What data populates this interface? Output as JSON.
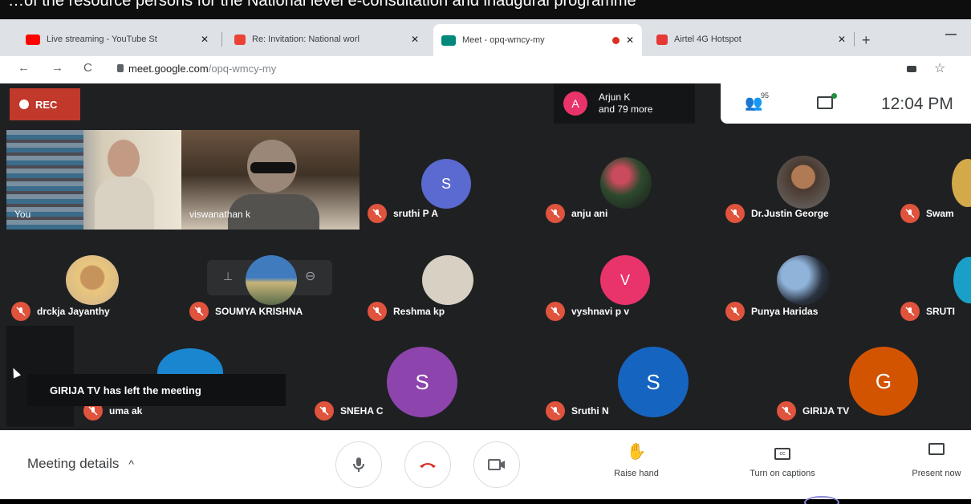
{
  "top_strip": {
    "text": "…of the resource persons for the National level e-consultation and inaugural programme"
  },
  "browser": {
    "tabs": [
      {
        "title": "Live streaming - YouTube St",
        "favicon_color": "#ff0000",
        "active": false
      },
      {
        "title": "Re: Invitation: National worl",
        "favicon_color": "#ea4335",
        "active": false
      },
      {
        "title": "Meet - opq-wmcy-my",
        "favicon_color": "#00897b",
        "active": true
      },
      {
        "title": "Airtel 4G Hotspot",
        "favicon_color": "#e53935",
        "active": false
      }
    ],
    "close_glyph": "✕",
    "new_tab_glyph": "+",
    "url_host": "meet.google.com",
    "url_path": "/opq-wmcy-my"
  },
  "meet": {
    "rec_label": "REC",
    "joined_avatar": "A",
    "joined_line1": "Arjun K",
    "joined_line2": "and 79 more",
    "people_count": "95",
    "time": "12:04 PM",
    "video_tiles": [
      {
        "name": "You"
      },
      {
        "name": "viswanathan k"
      }
    ],
    "participants": [
      {
        "name": "sruthi P A",
        "letter": "S",
        "color": "#5b6ad0"
      },
      {
        "name": "anju ani",
        "photo": true
      },
      {
        "name": "Dr.Justin George",
        "photo": true
      },
      {
        "name": "Swam",
        "photo": true
      },
      {
        "name": "drckja Jayanthy",
        "photo": true
      },
      {
        "name": "SOUMYA KRISHNA",
        "photo": true
      },
      {
        "name": "Reshma kp",
        "photo": true
      },
      {
        "name": "vyshnavi p v",
        "letter": "V",
        "color": "#e8336b"
      },
      {
        "name": "Punya Haridas",
        "photo": true
      },
      {
        "name": "SRUTI",
        "photo": true
      },
      {
        "name": "uma ak",
        "photo": true
      },
      {
        "name": "SNEHA C",
        "letter": "S",
        "color": "#8e44ad"
      },
      {
        "name": "Sruthi N",
        "letter": "S",
        "color": "#1565c0"
      },
      {
        "name": "GIRIJA TV",
        "letter": "G",
        "color": "#d35400"
      }
    ],
    "toast": "GIRIJA TV has left the meeting"
  },
  "controls": {
    "details_label": "Meeting details",
    "details_chevron": "^",
    "raise_hand": "Raise hand",
    "captions": "Turn on captions",
    "present": "Present now"
  }
}
